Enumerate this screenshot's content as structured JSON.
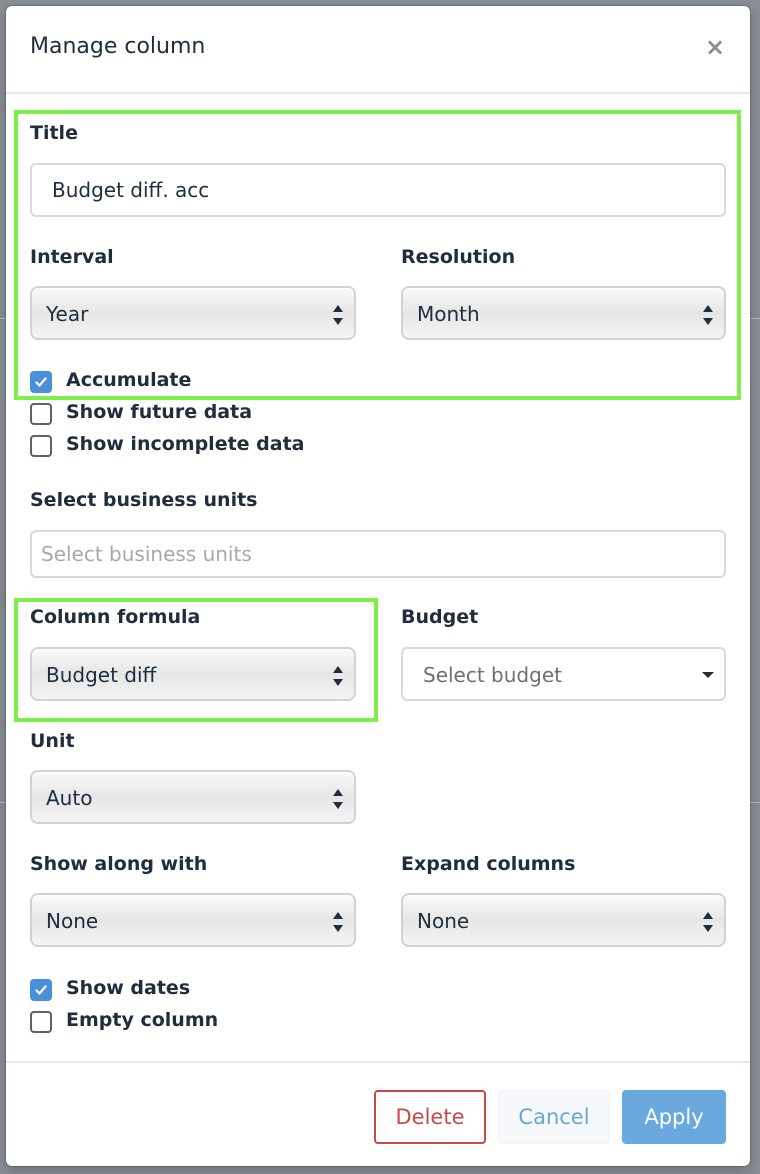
{
  "dialog": {
    "title": "Manage column"
  },
  "title_field": {
    "label": "Title",
    "value": "Budget diff. acc"
  },
  "interval": {
    "label": "Interval",
    "value": "Year"
  },
  "resolution": {
    "label": "Resolution",
    "value": "Month"
  },
  "checkboxes_top": {
    "accumulate": {
      "label": "Accumulate",
      "checked": true
    },
    "show_future": {
      "label": "Show future data",
      "checked": false
    },
    "show_incomplete": {
      "label": "Show incomplete data",
      "checked": false
    }
  },
  "business_units": {
    "label": "Select business units",
    "placeholder": "Select business units"
  },
  "column_formula": {
    "label": "Column formula",
    "value": "Budget diff"
  },
  "budget": {
    "label": "Budget",
    "placeholder": "Select budget"
  },
  "unit": {
    "label": "Unit",
    "value": "Auto"
  },
  "show_along_with": {
    "label": "Show along with",
    "value": "None"
  },
  "expand_columns": {
    "label": "Expand columns",
    "value": "None"
  },
  "checkboxes_bottom": {
    "show_dates": {
      "label": "Show dates",
      "checked": true
    },
    "empty_column": {
      "label": "Empty column",
      "checked": false
    }
  },
  "footer": {
    "delete_label": "Delete",
    "cancel_label": "Cancel",
    "apply_label": "Apply"
  },
  "colors": {
    "highlight": "#7ef04a",
    "primary": "#69a9de",
    "danger": "#c9484a",
    "checkbox_checked": "#4a90d9"
  }
}
